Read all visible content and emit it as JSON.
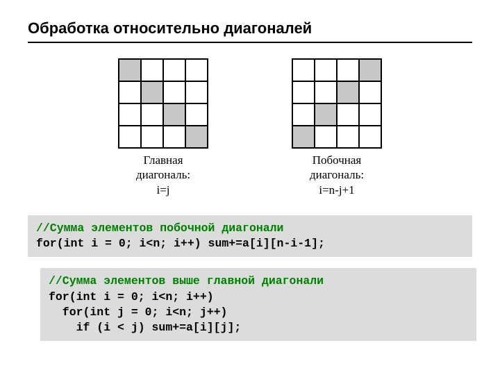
{
  "title": "Обработка относительно диагоналей",
  "grid1": {
    "caption_l1": "Главная",
    "caption_l2": "диагональ:",
    "caption_l3": "i=j",
    "cells": [
      [
        1,
        0,
        0,
        0
      ],
      [
        0,
        1,
        0,
        0
      ],
      [
        0,
        0,
        1,
        0
      ],
      [
        0,
        0,
        0,
        1
      ]
    ]
  },
  "grid2": {
    "caption_l1": "Побочная",
    "caption_l2": "диагональ:",
    "caption_l3": "i=n-j+1",
    "cells": [
      [
        0,
        0,
        0,
        1
      ],
      [
        0,
        0,
        1,
        0
      ],
      [
        0,
        1,
        0,
        0
      ],
      [
        1,
        0,
        0,
        0
      ]
    ]
  },
  "code1": {
    "comment": "//Сумма элементов побочной диагонали",
    "line1": "for(int i = 0; i<n; i++) sum+=a[i][n-i-1];"
  },
  "code2": {
    "comment": "//Сумма элементов выше главной диагонали",
    "line1": "for(int i = 0; i<n; i++)",
    "line2": "  for(int j = 0; i<n; j++)",
    "line3": "    if (i < j) sum+=a[i][j];"
  }
}
